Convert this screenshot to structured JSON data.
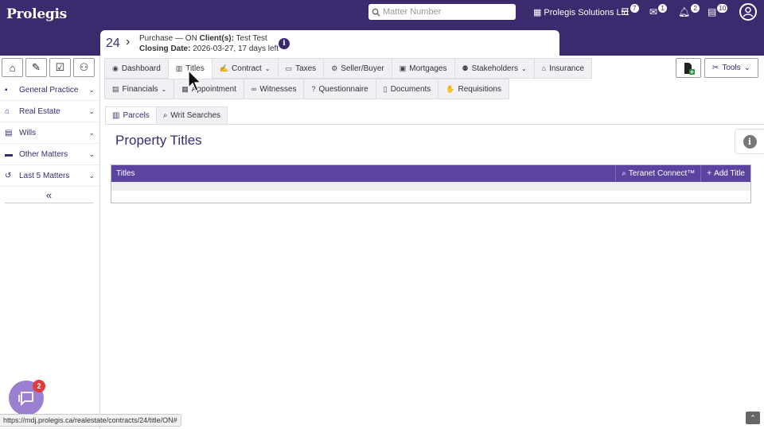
{
  "app": {
    "logo": "Prolegis"
  },
  "header": {
    "search_placeholder": "Matter Number",
    "company": "Prolegis Solutions Ltd",
    "badges": {
      "tasks": "7",
      "mail": "1",
      "notifications": "2",
      "documents": "10"
    }
  },
  "matter": {
    "number": "24",
    "type_line": "Purchase — ON",
    "client_label": "Client(s):",
    "client": "Test Test",
    "closing_label": "Closing Date:",
    "closing": "2026-03-27, 17 days left"
  },
  "sidebar": {
    "items": [
      {
        "label": "General Practice"
      },
      {
        "label": "Real Estate"
      },
      {
        "label": "Wills"
      },
      {
        "label": "Other Matters"
      },
      {
        "label": "Last 5 Matters"
      }
    ],
    "collapse": "«"
  },
  "tabs_row1": [
    {
      "label": "Dashboard"
    },
    {
      "label": "Titles"
    },
    {
      "label": "Contract"
    },
    {
      "label": "Taxes"
    },
    {
      "label": "Seller/Buyer"
    },
    {
      "label": "Mortgages"
    },
    {
      "label": "Stakeholders"
    },
    {
      "label": "Insurance"
    }
  ],
  "tabs_row2": [
    {
      "label": "Financials"
    },
    {
      "label": "Appointment"
    },
    {
      "label": "Witnesses"
    },
    {
      "label": "Questionnaire"
    },
    {
      "label": "Documents"
    },
    {
      "label": "Requisitions"
    }
  ],
  "tools_label": "Tools",
  "subtabs": [
    {
      "label": "Parcels"
    },
    {
      "label": "Writ Searches"
    }
  ],
  "page_title": "Property Titles",
  "table": {
    "header": "Titles",
    "teranet": "Teranet Connect™",
    "add": "Add Title"
  },
  "chat_badge": "2",
  "status_url": "https://mdj.prolegis.ca/realestate/contracts/24/title/ON#",
  "colors": {
    "primary": "#3c2a6e",
    "table_header": "#5b44a0",
    "chat": "#9b7fd1"
  }
}
